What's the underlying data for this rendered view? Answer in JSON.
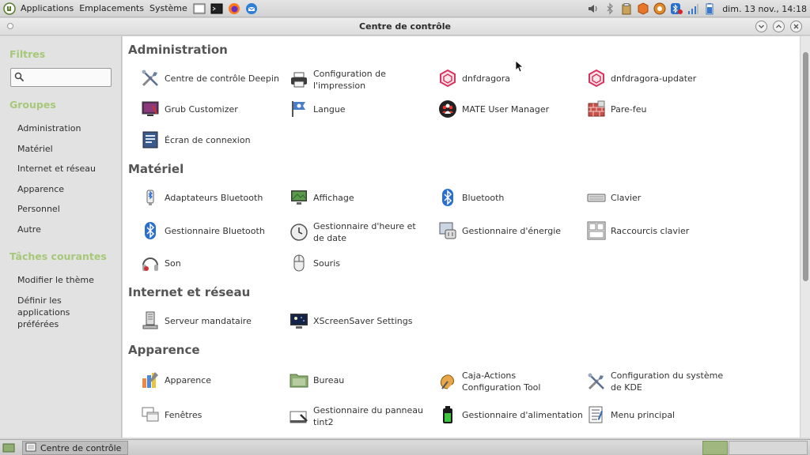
{
  "top_panel": {
    "menus": [
      "Applications",
      "Emplacements",
      "Système"
    ],
    "launchers": [
      "terminal-icon",
      "terminal-icon",
      "firefox-icon",
      "thunderbird-icon"
    ],
    "tray_icons": [
      "volume-icon",
      "bluetooth-icon",
      "clipboard-icon",
      "package-icon",
      "update-icon",
      "bluetooth-disabled-icon",
      "signal-icon",
      "battery-icon"
    ],
    "clock": "dim. 13 nov., 14:18"
  },
  "window": {
    "title": "Centre de contrôle"
  },
  "sidebar": {
    "filters_heading": "Filtres",
    "search_placeholder": "",
    "groups_heading": "Groupes",
    "groups": [
      "Administration",
      "Matériel",
      "Internet et réseau",
      "Apparence",
      "Personnel",
      "Autre"
    ],
    "tasks_heading": "Tâches courantes",
    "tasks": [
      "Modifier le thème",
      "Définir les applications préférées"
    ]
  },
  "sections": {
    "administration": {
      "title": "Administration",
      "items": [
        {
          "label": "Centre de contrôle Deepin",
          "icon": "tools-icon"
        },
        {
          "label": "Configuration de l'impression",
          "icon": "printer-icon"
        },
        {
          "label": "dnfdragora",
          "icon": "dnfdragora-icon"
        },
        {
          "label": "dnfdragora-updater",
          "icon": "dnfdragora-icon"
        },
        {
          "label": "Grub Customizer",
          "icon": "grub-icon"
        },
        {
          "label": "Langue",
          "icon": "flag-icon"
        },
        {
          "label": "MATE User Manager",
          "icon": "users-icon"
        },
        {
          "label": "Pare-feu",
          "icon": "firewall-icon"
        },
        {
          "label": "Écran de connexion",
          "icon": "login-screen-icon"
        }
      ]
    },
    "materiel": {
      "title": "Matériel",
      "items": [
        {
          "label": "Adaptateurs Bluetooth",
          "icon": "bluetooth-adapter-icon"
        },
        {
          "label": "Affichage",
          "icon": "display-icon"
        },
        {
          "label": "Bluetooth",
          "icon": "bluetooth-icon"
        },
        {
          "label": "Clavier",
          "icon": "keyboard-icon"
        },
        {
          "label": "Gestionnaire Bluetooth",
          "icon": "bluetooth-icon"
        },
        {
          "label": "Gestionnaire d'heure et de date",
          "icon": "clock-icon"
        },
        {
          "label": "Gestionnaire d'énergie",
          "icon": "power-manager-icon"
        },
        {
          "label": "Raccourcis clavier",
          "icon": "keyboard-shortcuts-icon"
        },
        {
          "label": "Son",
          "icon": "headphones-icon"
        },
        {
          "label": "Souris",
          "icon": "mouse-icon"
        }
      ]
    },
    "internet": {
      "title": "Internet et réseau",
      "items": [
        {
          "label": "Serveur mandataire",
          "icon": "proxy-server-icon"
        },
        {
          "label": "XScreenSaver Settings",
          "icon": "screensaver-icon"
        }
      ]
    },
    "apparence": {
      "title": "Apparence",
      "items": [
        {
          "label": "Apparence",
          "icon": "appearance-icon"
        },
        {
          "label": "Bureau",
          "icon": "desktop-folder-icon"
        },
        {
          "label": "Caja-Actions Configuration Tool",
          "icon": "caja-actions-icon"
        },
        {
          "label": "Configuration du système de KDE",
          "icon": "tools-icon"
        },
        {
          "label": "Fenêtres",
          "icon": "windows-icon"
        },
        {
          "label": "Gestionnaire du panneau tint2",
          "icon": "panel-icon"
        },
        {
          "label": "Gestionnaire d'alimentation",
          "icon": "battery-icon"
        },
        {
          "label": "Menu principal",
          "icon": "menu-editor-icon"
        }
      ]
    }
  },
  "bottom_panel": {
    "task_label": "Centre de contrôle"
  },
  "colors": {
    "sidebar_heading": "#a6c878",
    "accent_green": "#7e9a5e"
  }
}
